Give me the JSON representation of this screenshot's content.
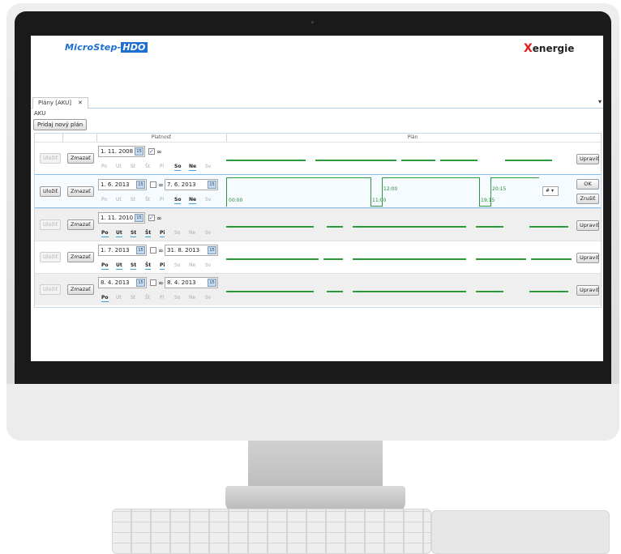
{
  "header": {
    "logo_left_main": "MicroStep",
    "logo_left_accent": "HDO",
    "logo_right_accent": "X",
    "logo_right_rest": "energie"
  },
  "tab": {
    "label": "Plány [AKU]",
    "close": "✕",
    "menu": "▾"
  },
  "breadcrumb": "AKU",
  "add_button": "Pridaj nový plán",
  "columns": {
    "validity": "Platnosť",
    "plan": "Plán"
  },
  "buttons": {
    "save": "Uložiť",
    "delete": "Zmazať",
    "edit": "Upraviť",
    "ok": "OK",
    "cancel": "Zrušiť"
  },
  "infinity": "∞",
  "calendar_icon_text": "15",
  "days": [
    "Po",
    "Ut",
    "St",
    "Št",
    "Pi",
    "So",
    "Ne",
    "Sv"
  ],
  "rows": [
    {
      "from": "1. 11. 2008",
      "to": "",
      "infinite": true,
      "active_days": [
        5,
        6
      ]
    },
    {
      "from": "1. 6. 2013",
      "to": "7. 6. 2013",
      "infinite": false,
      "active_days": [
        5,
        6
      ],
      "editing": true,
      "times": [
        "00:00",
        "11:00",
        "12:00",
        "19:15",
        "20:15"
      ],
      "select_value": "#"
    },
    {
      "from": "1. 11. 2010",
      "to": "",
      "infinite": true,
      "active_days": [
        0,
        1,
        2,
        3,
        4
      ]
    },
    {
      "from": "1. 7. 2013",
      "to": "31. 8. 2013",
      "infinite": false,
      "active_days": [
        0,
        1,
        2,
        3,
        4
      ]
    },
    {
      "from": "8. 4. 2013",
      "to": "8. 4. 2013",
      "infinite": false,
      "active_days": [
        0
      ]
    }
  ]
}
